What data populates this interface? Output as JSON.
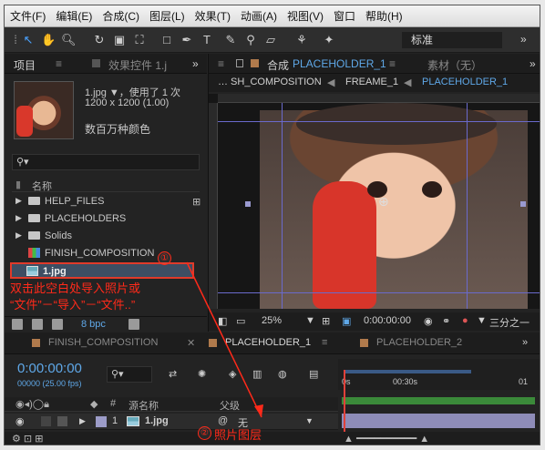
{
  "menu": [
    "文件(F)",
    "编辑(E)",
    "合成(C)",
    "图层(L)",
    "效果(T)",
    "动画(A)",
    "视图(V)",
    "窗口",
    "帮助(H)"
  ],
  "toolbar": {
    "workspace": "标准"
  },
  "project_panel": {
    "tab_project": "项目",
    "tab_effects": "效果控件 1.j",
    "file_name": "1.jpg ▼，使用了 1 次",
    "file_dims": "1200 x 1200 (1.00)",
    "file_colors": "数百万种颜色",
    "col_name": "名称",
    "items": [
      {
        "name": "HELP_FILES",
        "type": "folder"
      },
      {
        "name": "PLACEHOLDERS",
        "type": "folder"
      },
      {
        "name": "Solids",
        "type": "folder"
      },
      {
        "name": "FINISH_COMPOSITION",
        "type": "comp"
      },
      {
        "name": "1.jpg",
        "type": "image"
      }
    ],
    "bpc": "8 bpc"
  },
  "comp_panel": {
    "tab_title": "合成",
    "tab_comp": "PLACEHOLDER_1",
    "tab_footage": "素材（无）",
    "crumbs": [
      "… SH_COMPOSITION",
      "FREAME_1",
      "PLACEHOLDER_1"
    ],
    "zoom": "25%",
    "timecode": "0:00:00:00",
    "resolution": "三分之一"
  },
  "timeline": {
    "tabs": [
      "FINISH_COMPOSITION",
      "PLACEHOLDER_1",
      "PLACEHOLDER_2"
    ],
    "timecode": "0:00:00:00",
    "fps": "00000 (25.00 fps)",
    "ruler": [
      "0s",
      "00:30s",
      "01"
    ],
    "col_num": "#",
    "col_source": "源名称",
    "col_parent": "父级",
    "layer": {
      "num": "1",
      "name": "1.jpg",
      "parent": "无"
    }
  },
  "annotations": {
    "note1": "双击此空白处导入照片或",
    "note2": "“文件”－“导入”－“文件..”",
    "marker1": "①",
    "marker2": "②",
    "note3": "照片图层"
  },
  "colors": {
    "accent_blue": "#5fa8e8",
    "annotation_red": "#ff2a1a",
    "timeline_red": "#e0413a"
  }
}
